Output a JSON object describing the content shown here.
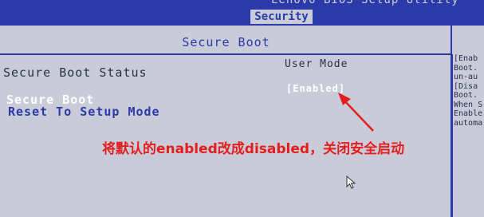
{
  "header": {
    "bios_title": "Lenovo BIOS Setup Utility",
    "active_tab": "Security"
  },
  "main": {
    "section_title": "Secure Boot",
    "secure_boot_status_label": "Secure Boot Status",
    "secure_boot_status_value": "User Mode",
    "secure_boot_label": "Secure Boot",
    "secure_boot_value": "[Enabled]",
    "reset_setup_mode_label": "Reset To Setup Mode"
  },
  "help": {
    "lines": [
      "[Enab",
      "Boot.",
      "un-au",
      "[Disa",
      "Boot.",
      "When S",
      "Enable",
      "automa"
    ]
  },
  "annotation": {
    "text": "将默认的enabled改成disabled，关闭安全启动",
    "color": "#e41d1d"
  },
  "colors": {
    "bios_blue": "#2c39a8",
    "background_gray": "#c9ccd8"
  }
}
